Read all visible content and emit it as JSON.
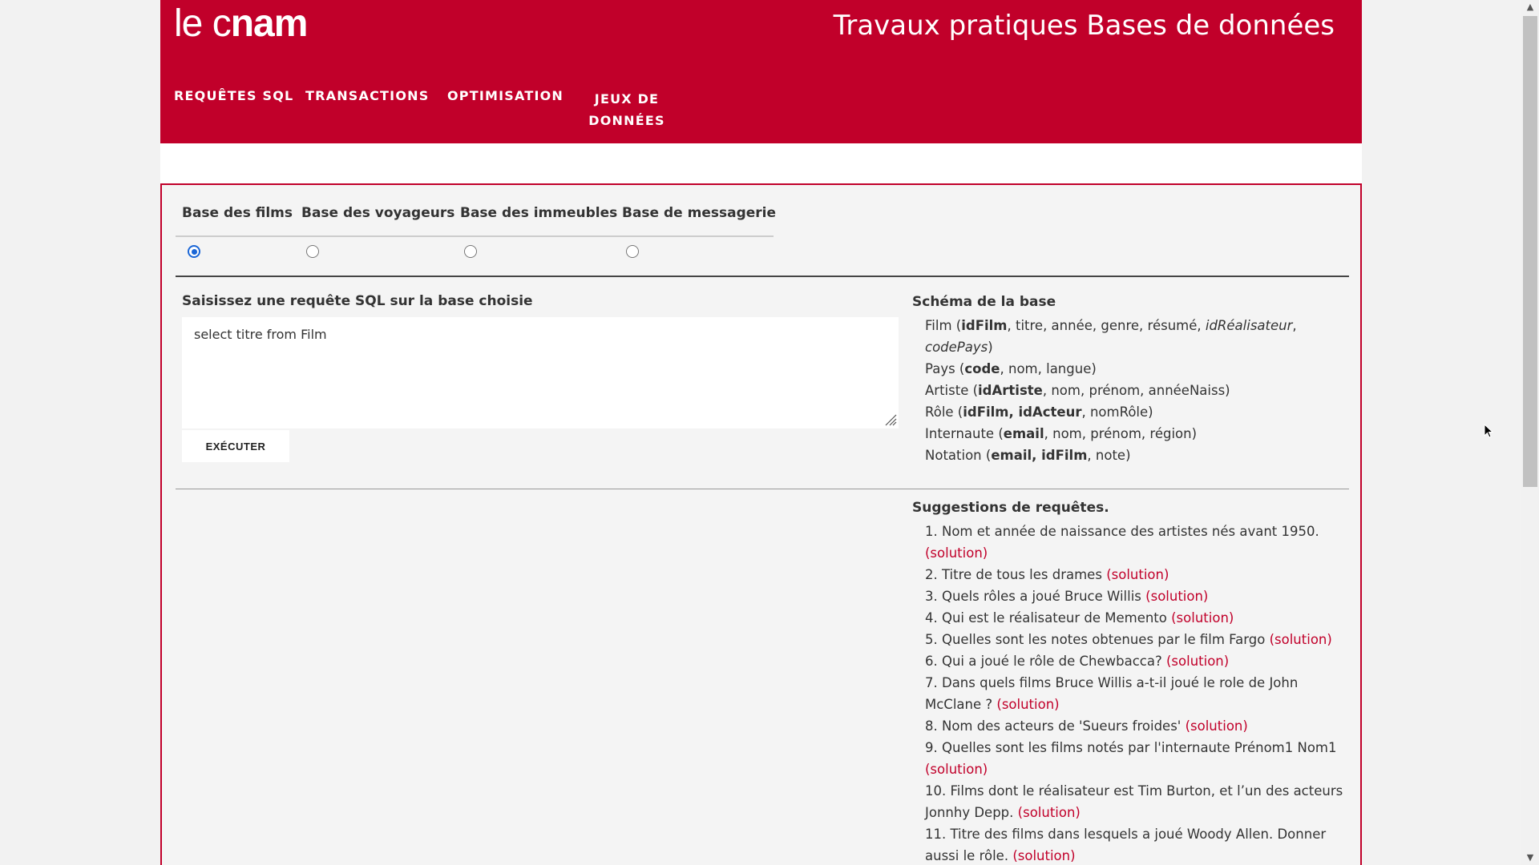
{
  "header": {
    "logo_thin": "le c",
    "logo_bold": "nam",
    "title": "Travaux pratiques Bases de données",
    "nav": [
      {
        "label": "Requêtes SQL"
      },
      {
        "label": "Transactions"
      },
      {
        "label": "Optimisation"
      },
      {
        "label": "Jeux de données"
      }
    ]
  },
  "databases": {
    "tabs": [
      "Base des films",
      "Base des voyageurs",
      "Base des immeubles",
      "Base de messagerie"
    ],
    "selected": "Base des films"
  },
  "query": {
    "label": "Saisissez une requête SQL sur la base choisie",
    "value": "select titre from Film",
    "execute_label": "EXÉCUTER"
  },
  "schema": {
    "title": "Schéma de la base",
    "tables": [
      {
        "name": "Film",
        "keys": "idFilm",
        "rest": ", titre, année, genre, résumé, ",
        "fk": "idRéalisateur",
        "rest2": ", ",
        "fk2": "codePays",
        "rest3": ")"
      },
      {
        "name": "Pays",
        "keys": "code",
        "rest": ", nom, langue)"
      },
      {
        "name": "Artiste",
        "keys": "idArtiste",
        "rest": ", nom, prénom, annéeNaiss)"
      },
      {
        "name": "Rôle",
        "keys": "idFilm, idActeur",
        "rest": ", nomRôle)"
      },
      {
        "name": "Internaute",
        "keys": "email",
        "rest": ", nom, prénom, région)"
      },
      {
        "name": "Notation",
        "keys": "email, idFilm",
        "rest": ", note)"
      }
    ]
  },
  "suggestions": {
    "title": "Suggestions de requêtes.",
    "solution_label": "(solution)",
    "items": [
      "1. Nom et année de naissance des artistes nés avant 1950.",
      "2. Titre de tous les drames",
      "3. Quels rôles a joué Bruce Willis",
      "4. Qui est le réalisateur de Memento",
      "5. Quelles sont les notes obtenues par le film Fargo",
      "6. Qui a joué le rôle de Chewbacca?",
      "7. Dans quels films Bruce Willis a-t-il joué le role de John McClane ?",
      "8. Nom des acteurs de 'Sueurs froides'",
      "9. Quelles sont les films notés par l'internaute Prénom1 Nom1",
      "10. Films dont le réalisateur est Tim Burton, et l’un des acteurs Jonnhy Depp.",
      "11. Titre des films dans lesquels a joué Woody Allen. Donner aussi le rôle."
    ]
  },
  "colors": {
    "brand": "#c1002a",
    "radio_selected": "#1a66d6"
  },
  "icons": {
    "scroll_up": "▲",
    "scroll_down": "▼"
  }
}
